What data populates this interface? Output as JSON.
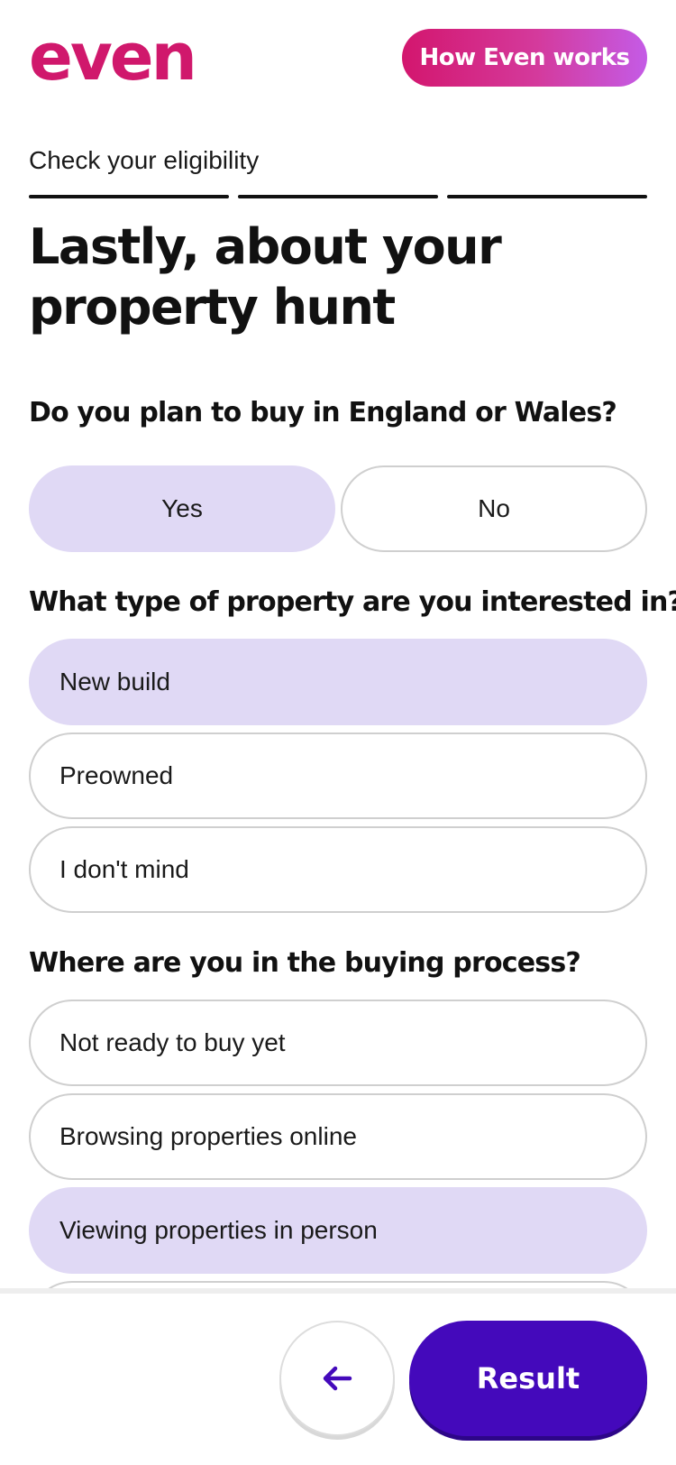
{
  "brand": {
    "logo_text": "even",
    "primary_color": "#d0186c",
    "accent_purple": "#4409bb",
    "selected_fill": "#e0d9f5"
  },
  "header": {
    "how_button_label": "How Even works"
  },
  "eyebrow": "Check your eligibility",
  "progress": {
    "steps_total": 3,
    "steps_completed": 3
  },
  "title": "Lastly, about your property hunt",
  "q1": {
    "question": "Do you plan to buy in England or Wales?",
    "options": [
      {
        "label": "Yes",
        "selected": true
      },
      {
        "label": "No",
        "selected": false
      }
    ]
  },
  "q2": {
    "question": "What type of property are you interested in?",
    "options": [
      {
        "label": "New build",
        "selected": true
      },
      {
        "label": "Preowned",
        "selected": false
      },
      {
        "label": "I don't mind",
        "selected": false
      }
    ]
  },
  "q3": {
    "question": "Where are you in the buying process?",
    "options": [
      {
        "label": "Not ready to buy yet",
        "selected": false
      },
      {
        "label": "Browsing properties online",
        "selected": false
      },
      {
        "label": "Viewing properties in person",
        "selected": true
      }
    ]
  },
  "footer": {
    "back_icon": "arrow-left-icon",
    "result_label": "Result"
  }
}
